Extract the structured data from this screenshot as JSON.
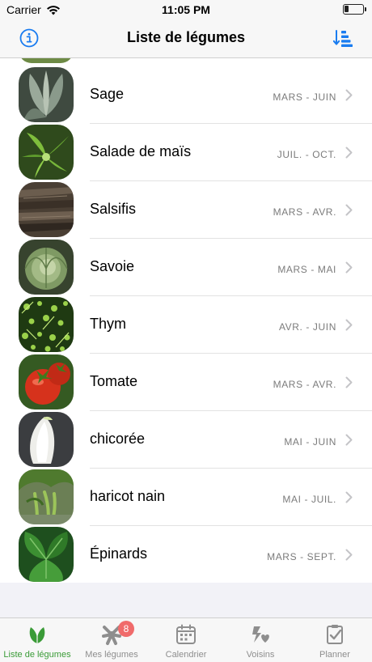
{
  "status_bar": {
    "carrier": "Carrier",
    "time": "11:05 PM",
    "battery_level": 0.25
  },
  "nav": {
    "title": "Liste de légumes",
    "info_icon": "info-circle-icon",
    "sort_icon": "sort-descending-icon"
  },
  "rows": [
    {
      "name": "Sage",
      "season": "MARS - JUIN",
      "image": "sage-thumbnail"
    },
    {
      "name": "Salade de maïs",
      "season": "JUIL. - OCT.",
      "image": "corn-salad-thumbnail"
    },
    {
      "name": "Salsifis",
      "season": "MARS - AVR.",
      "image": "salsify-thumbnail"
    },
    {
      "name": "Savoie",
      "season": "MARS - MAI",
      "image": "savoy-cabbage-thumbnail"
    },
    {
      "name": "Thym",
      "season": "AVR. - JUIN",
      "image": "thyme-thumbnail"
    },
    {
      "name": "Tomate",
      "season": "MARS - AVR.",
      "image": "tomato-thumbnail"
    },
    {
      "name": "chicorée",
      "season": "MAI - JUIN",
      "image": "chicory-thumbnail"
    },
    {
      "name": "haricot nain",
      "season": "MAI - JUIL.",
      "image": "dwarf-bean-thumbnail"
    },
    {
      "name": "Épinards",
      "season": "MARS - SEPT.",
      "image": "spinach-thumbnail"
    }
  ],
  "tabs": [
    {
      "label": "Liste de légumes",
      "icon": "leaves-icon",
      "active": true
    },
    {
      "label": "Mes légumes",
      "icon": "star-plant-icon",
      "badge": "8"
    },
    {
      "label": "Calendrier",
      "icon": "calendar-icon"
    },
    {
      "label": "Voisins",
      "icon": "neighbors-icon"
    },
    {
      "label": "Planner",
      "icon": "planner-icon"
    }
  ],
  "colors": {
    "accent_blue": "#1a7cf0",
    "active_green": "#3a9b37",
    "badge_red": "#f06b6b"
  }
}
